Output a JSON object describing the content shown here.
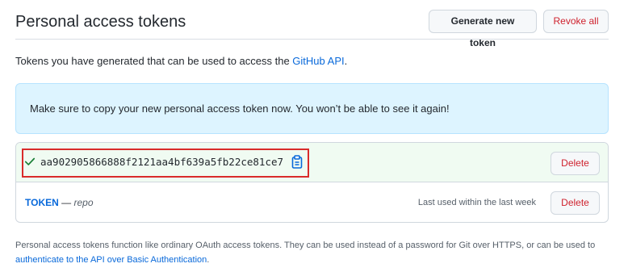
{
  "header": {
    "title": "Personal access tokens",
    "generate_label": "Generate new token",
    "revoke_label": "Revoke all"
  },
  "intro": {
    "text": "Tokens you have generated that can be used to access the ",
    "link": "GitHub API",
    "suffix": "."
  },
  "flash": {
    "message": "Make sure to copy your new personal access token now. You won’t be able to see it again!"
  },
  "tokens": {
    "new_token_value": "aa902905866888f2121aa4bf639a5fb22ce81ce7",
    "delete_label": "Delete",
    "existing": {
      "name": "TOKEN",
      "separator": " — ",
      "scope": "repo",
      "last_used": "Last used within the last week",
      "delete_label": "Delete"
    }
  },
  "footer": {
    "text": "Personal access tokens function like ordinary OAuth access tokens. They can be used instead of a password for Git over HTTPS, or can be used to ",
    "link": "authenticate to the API over Basic Authentication",
    "suffix": "."
  },
  "icons": {
    "check": "check-icon",
    "copy": "clipboard-icon"
  },
  "colors": {
    "link": "#0969da",
    "danger": "#cf222e",
    "success": "#1a7f37",
    "flash_bg": "#ddf4ff",
    "new_row_bg": "#f0fbf2",
    "highlight_border": "#d92b2b"
  }
}
